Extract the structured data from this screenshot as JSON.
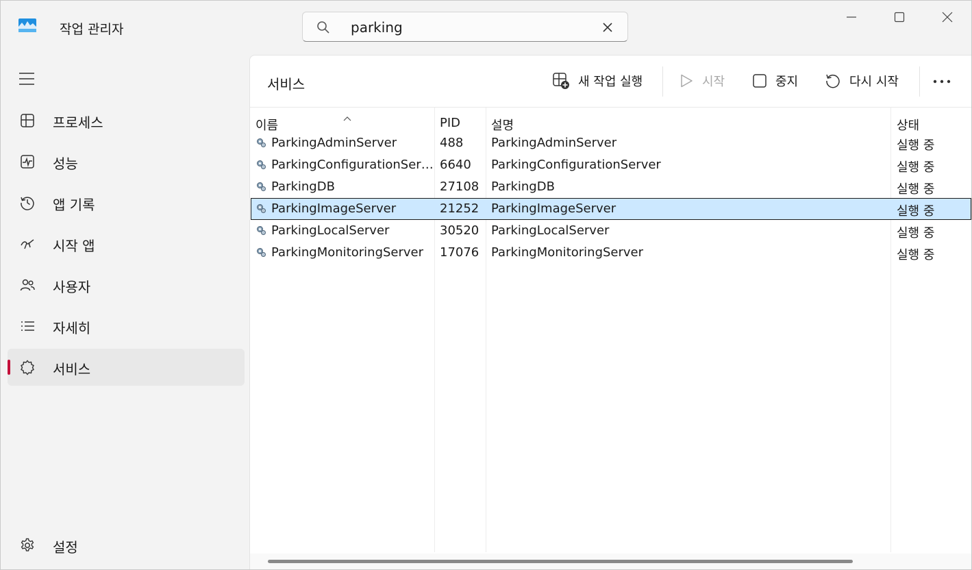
{
  "app": {
    "title": "작업 관리자",
    "accent_color": "#c4103a",
    "selection_color": "#cce8ff"
  },
  "search": {
    "value": "parking",
    "placeholder": ""
  },
  "sidebar": {
    "items": [
      {
        "label": "프로세스",
        "icon": "processes-icon"
      },
      {
        "label": "성능",
        "icon": "performance-icon"
      },
      {
        "label": "앱 기록",
        "icon": "history-icon"
      },
      {
        "label": "시작 앱",
        "icon": "startup-icon"
      },
      {
        "label": "사용자",
        "icon": "users-icon"
      },
      {
        "label": "자세히",
        "icon": "details-icon"
      },
      {
        "label": "서비스",
        "icon": "services-icon",
        "active": true
      }
    ],
    "settings_label": "설정"
  },
  "main": {
    "title": "서비스",
    "toolbar": {
      "new_task": "새 작업 실행",
      "start": "시작",
      "stop": "중지",
      "restart": "다시 시작"
    },
    "columns": {
      "name": "이름",
      "pid": "PID",
      "desc": "설명",
      "status": "상태"
    },
    "rows": [
      {
        "name": "ParkingAdminServer",
        "pid": "488",
        "desc": "ParkingAdminServer",
        "status": "실행 중"
      },
      {
        "name": "ParkingConfigurationServer",
        "pid": "6640",
        "desc": "ParkingConfigurationServer",
        "status": "실행 중"
      },
      {
        "name": "ParkingDB",
        "pid": "27108",
        "desc": "ParkingDB",
        "status": "실행 중"
      },
      {
        "name": "ParkingImageServer",
        "pid": "21252",
        "desc": "ParkingImageServer",
        "status": "실행 중",
        "selected": true
      },
      {
        "name": "ParkingLocalServer",
        "pid": "30520",
        "desc": "ParkingLocalServer",
        "status": "실행 중"
      },
      {
        "name": "ParkingMonitoringServer",
        "pid": "17076",
        "desc": "ParkingMonitoringServer",
        "status": "실행 중"
      }
    ]
  }
}
